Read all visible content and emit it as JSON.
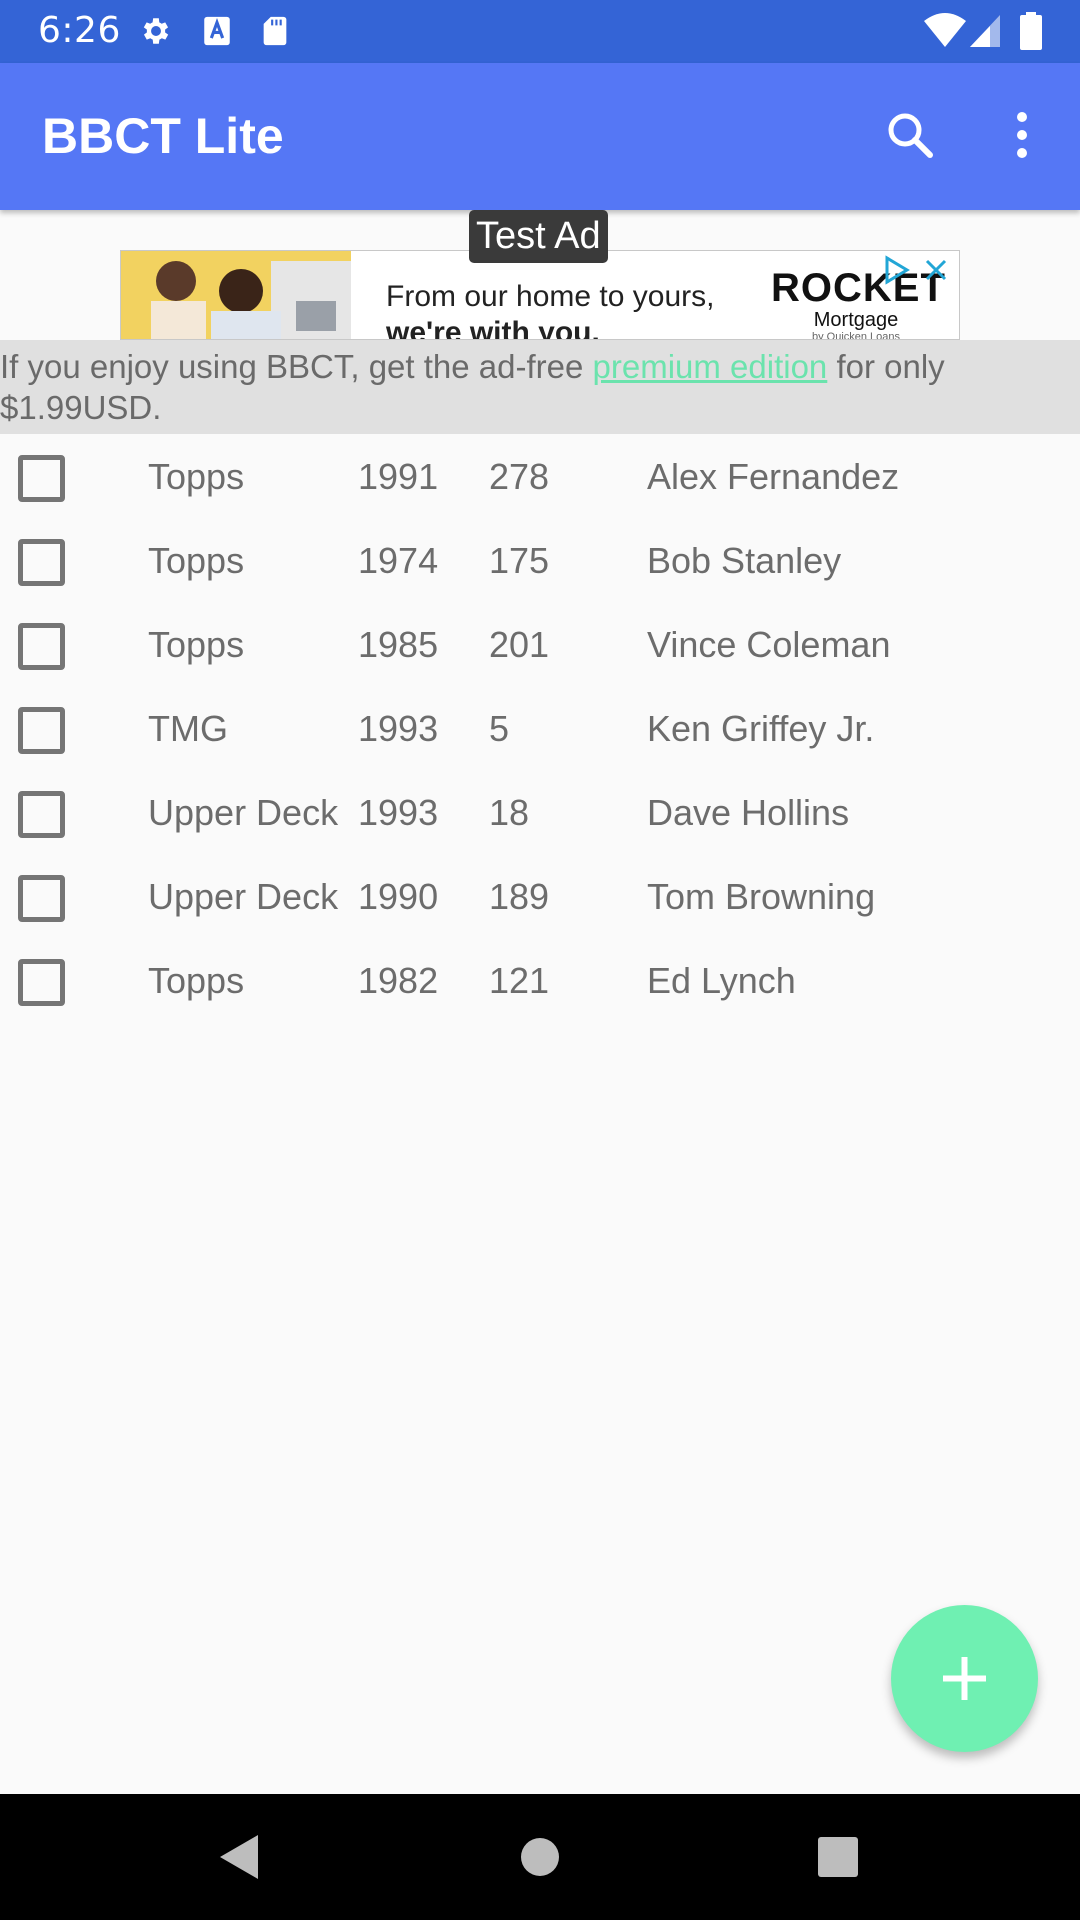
{
  "status_bar": {
    "time": "6:26",
    "icons": [
      "gear-icon",
      "a-icon",
      "sd-card-icon",
      "wifi-icon",
      "signal-icon",
      "battery-icon"
    ]
  },
  "app_bar": {
    "title": "BBCT Lite",
    "actions": [
      "search-icon",
      "more-vert-icon"
    ],
    "color": "#5577f5"
  },
  "ad": {
    "label": "Test Ad",
    "headline_line1": "From our home to yours,",
    "headline_line2": "we're with you.",
    "brand_name": "ROCKET",
    "brand_sub": "Mortgage",
    "brand_tiny": "by Quicken Loans"
  },
  "premium_notice": {
    "prefix": "If you enjoy using BBCT, get the ad-free ",
    "link": "premium edition",
    "suffix": " for only $1.99USD.",
    "link_color": "#6be3ad"
  },
  "cards": [
    {
      "brand": "Topps",
      "year": "1991",
      "number": "278",
      "player": "Alex Fernandez"
    },
    {
      "brand": "Topps",
      "year": "1974",
      "number": "175",
      "player": "Bob Stanley"
    },
    {
      "brand": "Topps",
      "year": "1985",
      "number": "201",
      "player": "Vince Coleman"
    },
    {
      "brand": "TMG",
      "year": "1993",
      "number": "5",
      "player": "Ken Griffey Jr."
    },
    {
      "brand": "Upper Deck",
      "year": "1993",
      "number": "18",
      "player": "Dave Hollins"
    },
    {
      "brand": "Upper Deck",
      "year": "1990",
      "number": "189",
      "player": "Tom Browning"
    },
    {
      "brand": "Topps",
      "year": "1982",
      "number": "121",
      "player": "Ed Lynch"
    }
  ],
  "fab": {
    "icon": "plus-icon",
    "color": "#6ff0b2"
  },
  "nav_bar": {
    "icons": [
      "back-icon",
      "home-icon",
      "recents-icon"
    ]
  }
}
